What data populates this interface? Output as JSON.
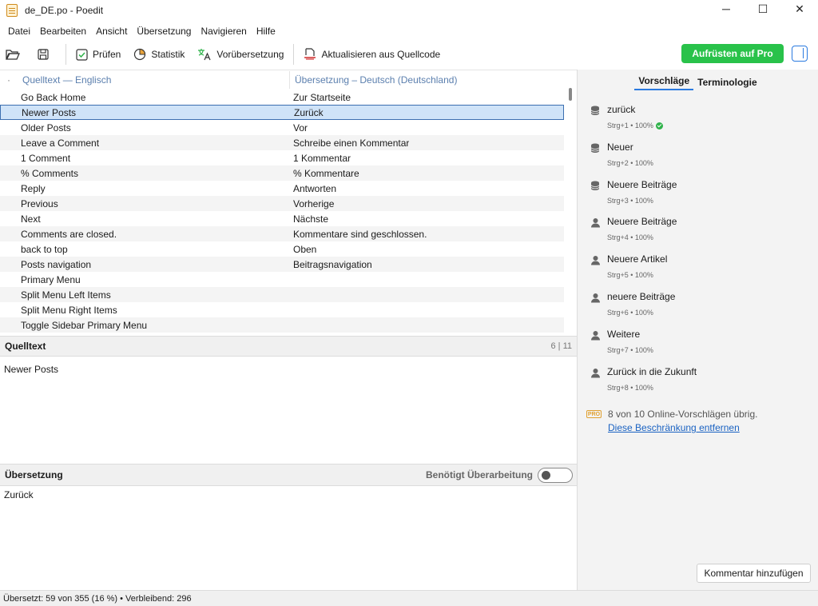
{
  "window": {
    "title": "de_DE.po - Poedit",
    "minimize": "─",
    "maximize": "☐",
    "close": "✕"
  },
  "menu": [
    "Datei",
    "Bearbeiten",
    "Ansicht",
    "Übersetzung",
    "Navigieren",
    "Hilfe"
  ],
  "toolbar": {
    "validate": "Prüfen",
    "statistics": "Statistik",
    "pretranslate": "Vorübersetzung",
    "update_source": "Aktualisieren aus Quellcode",
    "upgrade_pro": "Aufrüsten auf Pro"
  },
  "list": {
    "dot": "·",
    "source_header": "Quelltext — Englisch",
    "translation_header": "Übersetzung – Deutsch (Deutschland)",
    "rows": [
      {
        "source": "Go Back Home",
        "translation": "Zur Startseite"
      },
      {
        "source": "Newer Posts",
        "translation": "Zurück"
      },
      {
        "source": "Older Posts",
        "translation": "Vor"
      },
      {
        "source": "Leave a Comment",
        "translation": "Schreibe einen Kommentar"
      },
      {
        "source": "1 Comment",
        "translation": "1 Kommentar"
      },
      {
        "source": "% Comments",
        "translation": "% Kommentare"
      },
      {
        "source": "Reply",
        "translation": "Antworten"
      },
      {
        "source": "Previous",
        "translation": "Vorherige"
      },
      {
        "source": "Next",
        "translation": "Nächste"
      },
      {
        "source": "Comments are closed.",
        "translation": "Kommentare sind geschlossen."
      },
      {
        "source": "back to top",
        "translation": "Oben"
      },
      {
        "source": "Posts navigation",
        "translation": "Beitragsnavigation"
      },
      {
        "source": "Primary Menu",
        "translation": ""
      },
      {
        "source": "Split Menu Left Items",
        "translation": ""
      },
      {
        "source": "Split Menu Right Items",
        "translation": ""
      },
      {
        "source": "Toggle Sidebar Primary Menu",
        "translation": ""
      }
    ],
    "selected_index": 1
  },
  "source_panel": {
    "label": "Quelltext",
    "count": "6 | 11",
    "text": "Newer Posts"
  },
  "translation_panel": {
    "label": "Übersetzung",
    "needs_work": "Benötigt Überarbeitung",
    "text": "Zurück"
  },
  "sidebar": {
    "tabs": [
      "Vorschläge",
      "Terminologie"
    ],
    "suggestions": [
      {
        "text": "zurück",
        "meta": "Strg+1 • 100%",
        "icon": "database-icon",
        "check": true
      },
      {
        "text": "Neuer",
        "meta": "Strg+2 • 100%",
        "icon": "database-icon",
        "check": false
      },
      {
        "text": "Neuere Beiträge",
        "meta": "Strg+3 • 100%",
        "icon": "database-icon",
        "check": false
      },
      {
        "text": "Neuere Beiträge",
        "meta": "Strg+4 • 100%",
        "icon": "user-icon",
        "check": false
      },
      {
        "text": "Neuere Artikel",
        "meta": "Strg+5 • 100%",
        "icon": "user-icon",
        "check": false
      },
      {
        "text": "neuere Beiträge",
        "meta": "Strg+6 • 100%",
        "icon": "user-icon",
        "check": false
      },
      {
        "text": "Weitere",
        "meta": "Strg+7 • 100%",
        "icon": "user-icon",
        "check": false
      },
      {
        "text": "Zurück in die Zukunft",
        "meta": "Strg+8 • 100%",
        "icon": "user-icon",
        "check": false
      }
    ],
    "pro_badge": "PRO",
    "remaining": "8 von 10 Online-Vorschlägen übrig.",
    "remove_limit": "Diese Beschränkung entfernen",
    "add_comment": "Kommentar hinzufügen"
  },
  "status": "Übersetzt: 59 von 355 (16 %)  •  Verbleibend: 296",
  "colors": {
    "accent": "#2a7ae0",
    "pro_green": "#29c24a",
    "selected_row": "#cfe3f8",
    "link": "#1a62c2"
  }
}
